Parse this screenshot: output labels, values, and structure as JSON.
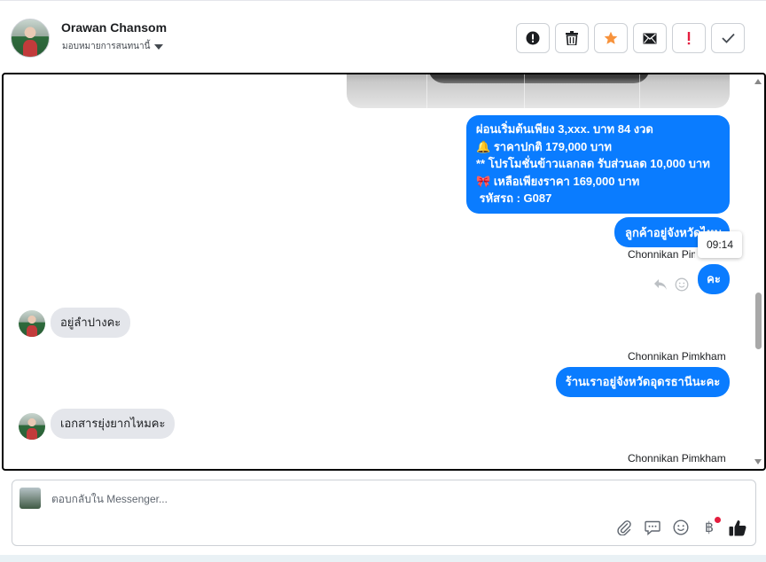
{
  "header": {
    "contact_name": "Orawan Chansom",
    "assign_label": "มอบหมายการสนทนานี้",
    "actions": [
      {
        "name": "spam-button",
        "icon": "alert-circle-icon"
      },
      {
        "name": "delete-button",
        "icon": "trash-icon"
      },
      {
        "name": "star-button",
        "icon": "star-icon",
        "color": "#f7923b"
      },
      {
        "name": "mark-unread-button",
        "icon": "envelope-icon"
      },
      {
        "name": "follow-up-button",
        "icon": "exclamation-icon",
        "color": "#e41e3f"
      },
      {
        "name": "mark-done-button",
        "icon": "check-icon"
      }
    ]
  },
  "messages": {
    "promo_lines": [
      "ผ่อนเริ่มต้นเพียง 3,xxx. บาท 84 งวด",
      "ราคาปกติ 179,000 บาท",
      "** โปรโมชั่นข้าวแลกลด รับส่วนลด 10,000 บาท",
      "เหลือเพียงราคา 169,000 บาท",
      " รหัสรถ : G087"
    ],
    "promo_emoji": [
      "🔔",
      "🎀"
    ],
    "location_question": "ลูกค้าอยู่จังหวัดไหน",
    "tooltip_time": "09:14",
    "sender_1": "Chonnikan Pimkham",
    "ka": "คะ",
    "incoming_1": "อยู่ลำปางคะ",
    "sender_2": "Chonnikan Pimkham",
    "shop_location": "ร้านเราอยู่จังหวัดอุดรธานีนะคะ",
    "incoming_2": "เอกสารยุ่งยากไหมคะ",
    "sender_3": "Chonnikan Pimkham"
  },
  "composer": {
    "placeholder": "ตอบกลับใน Messenger...",
    "tools": [
      "paperclip-icon",
      "saved-reply-icon",
      "emoji-icon",
      "baht-icon",
      "like-icon"
    ],
    "baht_symbol": "฿"
  },
  "colors": {
    "outgoing": "#0a7cff",
    "incoming": "#e4e6eb",
    "star": "#f7923b",
    "alert": "#e41e3f"
  }
}
